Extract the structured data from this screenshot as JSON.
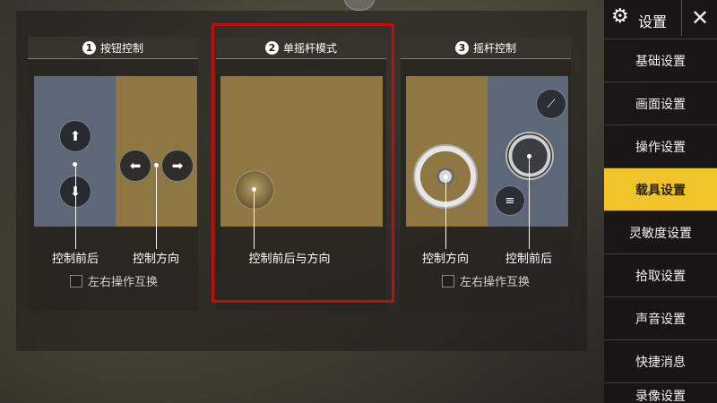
{
  "header": {
    "title": "设置",
    "close_icon": "close-icon",
    "gear_icon": "gear-icon"
  },
  "panels": [
    {
      "number": "1",
      "title": "按钮控制",
      "label_left": "控制前后",
      "label_right": "控制方向",
      "swap_label": "左右操作互换",
      "swap_checked": false
    },
    {
      "number": "2",
      "title": "单摇杆模式",
      "label_center": "控制前后与方向",
      "selected": true
    },
    {
      "number": "3",
      "title": "摇杆控制",
      "label_left": "控制方向",
      "label_right": "控制前后",
      "swap_label": "左右操作互换",
      "swap_checked": false
    }
  ],
  "icons": {
    "up": "⬆",
    "down": "⬇",
    "left": "⬅",
    "right": "➡",
    "horn": "≡",
    "handbrake": "⟋"
  },
  "sidebar": {
    "items": [
      {
        "label": "基础设置",
        "active": false
      },
      {
        "label": "画面设置",
        "active": false
      },
      {
        "label": "操作设置",
        "active": false
      },
      {
        "label": "载具设置",
        "active": true
      },
      {
        "label": "灵敏度设置",
        "active": false
      },
      {
        "label": "拾取设置",
        "active": false
      },
      {
        "label": "声音设置",
        "active": false
      },
      {
        "label": "快捷消息",
        "active": false
      },
      {
        "label": "录像设置",
        "active": false
      }
    ]
  },
  "colors": {
    "accent": "#f2c42b",
    "selection": "#c10d0d",
    "pane_blue": "#5d6778",
    "pane_gold": "#8e7742"
  }
}
